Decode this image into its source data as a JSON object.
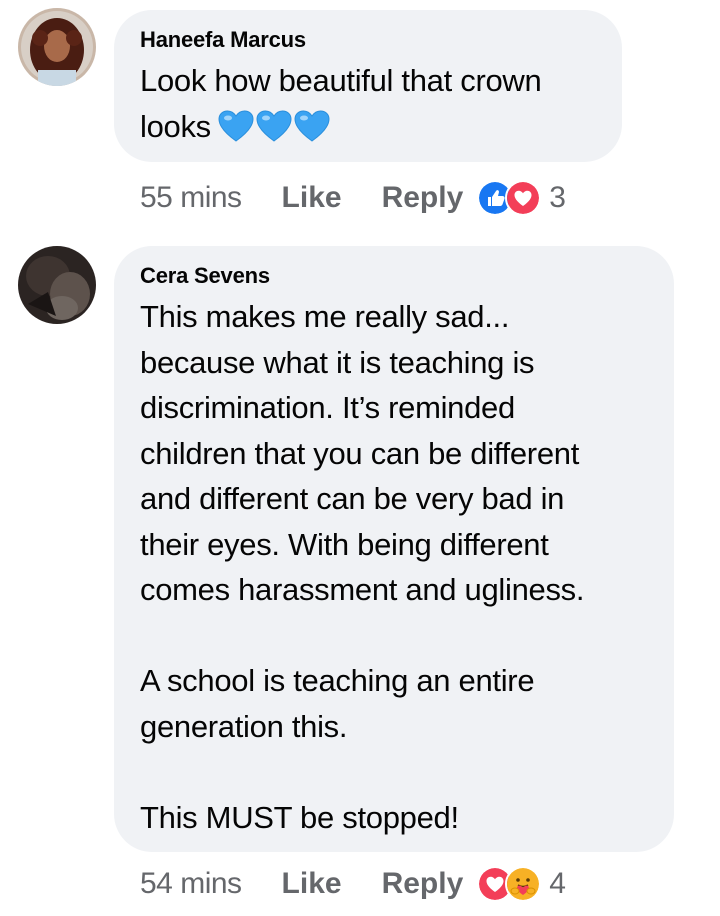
{
  "comments": [
    {
      "author": "Haneefa Marcus",
      "paragraphs": [
        [
          "Look how beautiful that crown",
          "looks"
        ]
      ],
      "emoji": [
        "blue-heart",
        "blue-heart",
        "blue-heart"
      ],
      "time": "55 mins",
      "like_label": "Like",
      "reply_label": "Reply",
      "reactions": [
        "like",
        "love"
      ],
      "reaction_count": "3"
    },
    {
      "author": "Cera Sevens",
      "paragraphs": [
        [
          "This makes me really sad...",
          "because what it is teaching is",
          "discrimination. It’s reminded",
          "children that you can be different",
          "and different can be very bad in",
          "their eyes. With being different",
          "comes harassment and ugliness."
        ],
        [
          "A school is teaching an entire",
          "generation this."
        ],
        [
          "This MUST be stopped!"
        ]
      ],
      "time": "54 mins",
      "like_label": "Like",
      "reply_label": "Reply",
      "reactions": [
        "love",
        "care"
      ],
      "reaction_count": "4"
    }
  ],
  "colors": {
    "bubble_bg": "#f0f2f5",
    "meta_text": "#65676b",
    "like_blue": "#1877f2",
    "love_red": "#f33e58",
    "care_yellow": "#f7b125",
    "heart_blue": "#3aa3f2"
  }
}
